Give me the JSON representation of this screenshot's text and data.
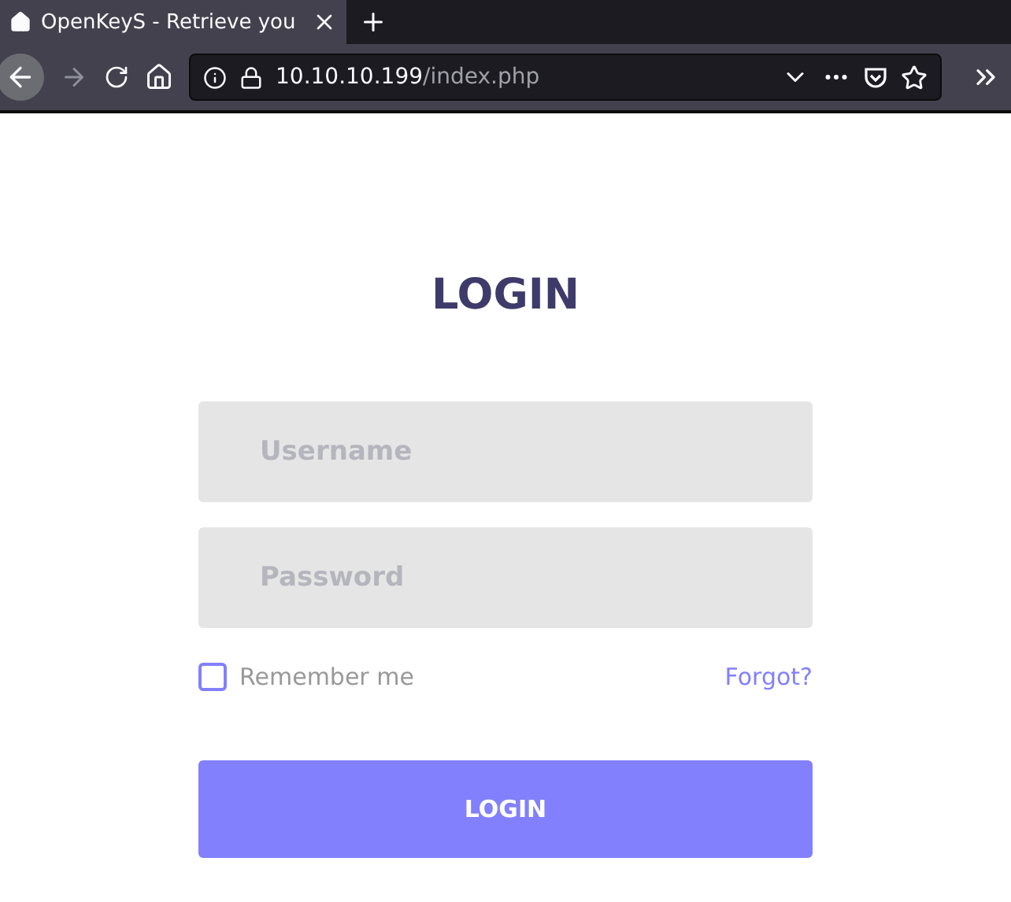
{
  "browser": {
    "tab": {
      "title": "OpenKeyS - Retrieve you",
      "selected": true
    },
    "url": {
      "host": "10.10.10.199",
      "path": "/index.php"
    }
  },
  "login": {
    "title": "LOGIN",
    "fields": [
      {
        "placeholder": "Username"
      },
      {
        "placeholder": "Password"
      }
    ],
    "remember": {
      "label": "Remember me",
      "checked": false
    },
    "forgot": "Forgot?",
    "submit": "LOGIN"
  }
}
